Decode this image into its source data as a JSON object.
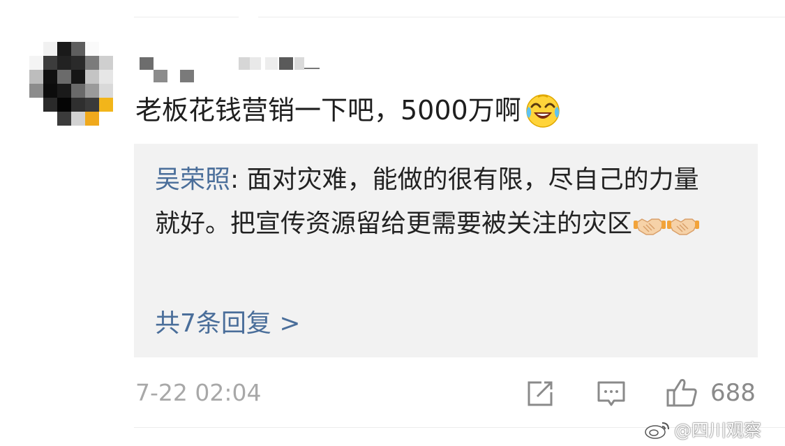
{
  "comment": {
    "text": "老板花钱营销一下吧，5000万啊",
    "emoji": "laughing-crying-face"
  },
  "reply": {
    "author": "吴荣照",
    "separator": ": ",
    "text": "面对灾难，能做的很有限，尽自己的力量就好。把宣传资源留给更需要被关注的灾区",
    "emoji": [
      "handshake",
      "handshake"
    ],
    "view_replies_label": "共7条回复 >"
  },
  "footer": {
    "timestamp": "7-22 02:04",
    "like_count": "688",
    "icons": [
      "share-icon",
      "comment-icon",
      "like-icon"
    ]
  },
  "watermark": {
    "text": "@四川观察",
    "logo": "weibo-logo"
  },
  "colors": {
    "link_blue": "#4a6e9a",
    "reply_background": "#f2f2f2",
    "meta_gray": "#a8a8a8"
  }
}
